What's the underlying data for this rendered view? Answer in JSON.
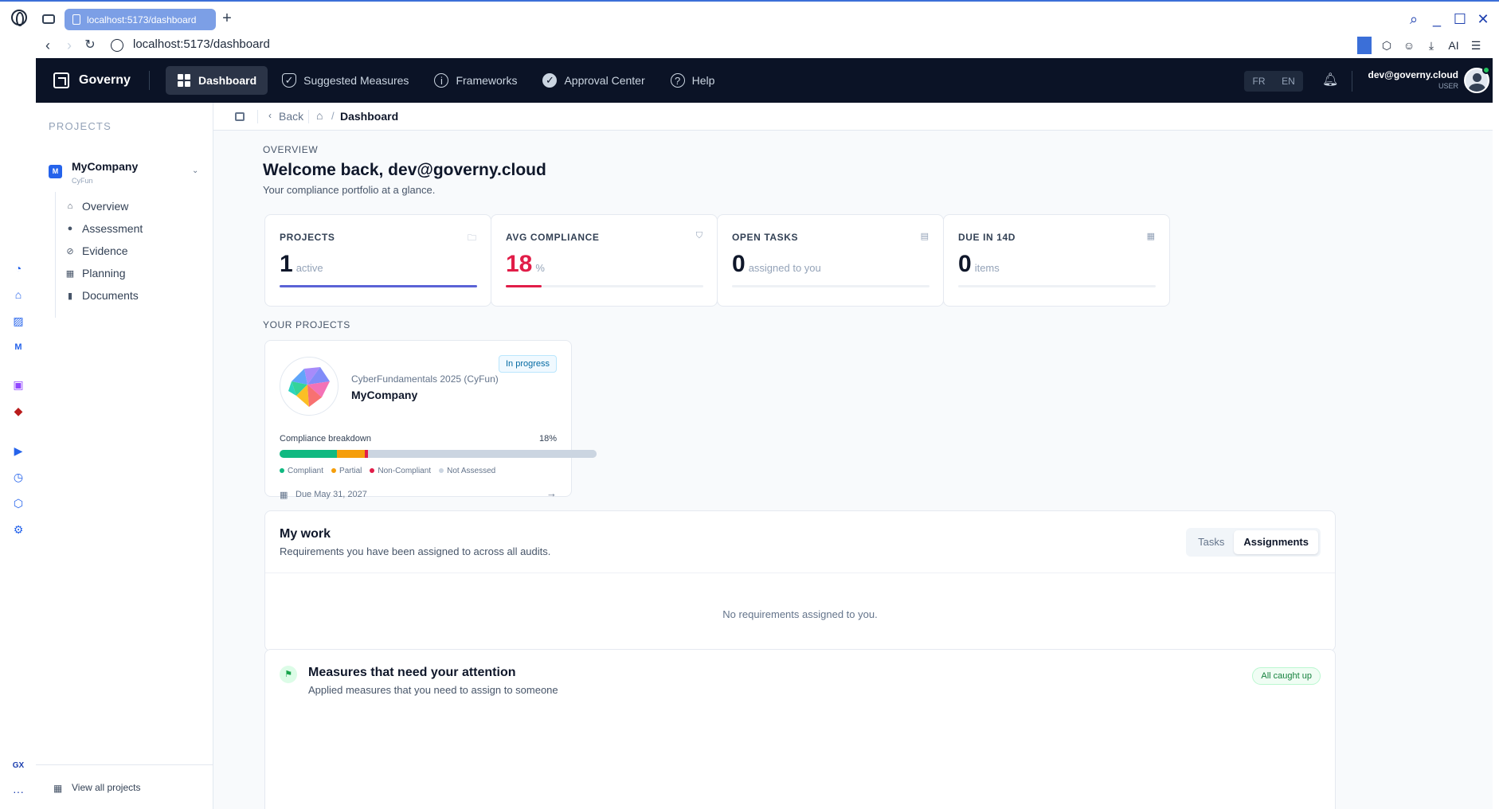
{
  "browser": {
    "tab_title": "localhost:5173/dashboard",
    "new_tab": "+",
    "url": "localhost:5173/dashboard",
    "ai_label": "AI"
  },
  "opera_sidebar": {
    "icons": [
      "speed-dial-icon",
      "crypto-wallet-icon",
      "gallery-icon",
      "messenger-icon",
      "twitch-icon",
      "adblock-icon",
      "player-icon",
      "history-icon",
      "extensions-icon",
      "settings-icon",
      "gx-icon",
      "more-icon"
    ],
    "gx_label": "GX",
    "more_label": "···"
  },
  "topnav": {
    "brand": "Governy",
    "items": [
      {
        "label": "Dashboard",
        "icon": "grid-icon",
        "active": true
      },
      {
        "label": "Suggested Measures",
        "icon": "shield-icon",
        "active": false
      },
      {
        "label": "Frameworks",
        "icon": "info-icon",
        "active": false
      },
      {
        "label": "Approval Center",
        "icon": "check-badge-icon",
        "active": false
      },
      {
        "label": "Help",
        "icon": "help-icon",
        "active": false
      }
    ],
    "languages": [
      "FR",
      "EN"
    ],
    "user_email": "dev@governy.cloud",
    "user_role": "USER"
  },
  "project_sidebar": {
    "heading": "PROJECTS",
    "company": {
      "badge": "M",
      "name": "MyCompany",
      "framework": "CyFun"
    },
    "items": [
      {
        "label": "Overview",
        "icon": "home-icon"
      },
      {
        "label": "Assessment",
        "icon": "check-circle-icon"
      },
      {
        "label": "Evidence",
        "icon": "paperclip-icon"
      },
      {
        "label": "Planning",
        "icon": "calendar-icon"
      },
      {
        "label": "Documents",
        "icon": "document-icon"
      }
    ],
    "footer_link": "View all projects"
  },
  "breadcrumb": {
    "back": "Back",
    "current": "Dashboard",
    "separator": "/"
  },
  "overview": {
    "eyebrow": "OVERVIEW",
    "title": "Welcome back, dev@governy.cloud",
    "subtitle": "Your compliance portfolio at a glance."
  },
  "stats": [
    {
      "label": "PROJECTS",
      "value": "1",
      "unit": "active",
      "icon": "folder-icon",
      "fill": 1.0,
      "color": "#5b63d6"
    },
    {
      "label": "AVG COMPLIANCE",
      "value": "18",
      "unit": "%",
      "icon": "shield-icon",
      "fill": 0.18,
      "color": "#e11d48"
    },
    {
      "label": "OPEN TASKS",
      "value": "0",
      "unit": "assigned to you",
      "icon": "clipboard-icon",
      "fill": 0,
      "color": "#5b63d6"
    },
    {
      "label": "DUE IN 14D",
      "value": "0",
      "unit": "items",
      "icon": "calendar-icon",
      "fill": 0,
      "color": "#5b63d6"
    }
  ],
  "your_projects": {
    "label": "YOUR PROJECTS",
    "card": {
      "framework": "CyberFundamentals 2025 (CyFun)",
      "name": "MyCompany",
      "status": "In progress",
      "breakdown_label": "Compliance breakdown",
      "breakdown_value": "18%",
      "segments": [
        {
          "name": "Compliant",
          "fraction": 0.18,
          "color": "#10b981"
        },
        {
          "name": "Partial",
          "fraction": 0.09,
          "color": "#f59e0b"
        },
        {
          "name": "Non-Compliant",
          "fraction": 0.01,
          "color": "#e11d48"
        },
        {
          "name": "Not Assessed",
          "fraction": 0.72,
          "color": "#cbd5e1"
        }
      ],
      "legend": [
        "Compliant",
        "Partial",
        "Non-Compliant",
        "Not Assessed"
      ],
      "due": "Due May 31, 2027",
      "arrow": "→"
    }
  },
  "my_work": {
    "title": "My work",
    "subtitle": "Requirements you have been assigned to across all audits.",
    "tabs": [
      "Tasks",
      "Assignments"
    ],
    "active_tab": "Assignments",
    "empty": "No requirements assigned to you."
  },
  "attention": {
    "title": "Measures that need your attention",
    "subtitle": "Applied measures that you need to assign to someone",
    "badge": "All caught up"
  },
  "colors": {
    "accent": "#5b63d6",
    "nav_bg": "#0b1326",
    "danger": "#e11d48"
  }
}
